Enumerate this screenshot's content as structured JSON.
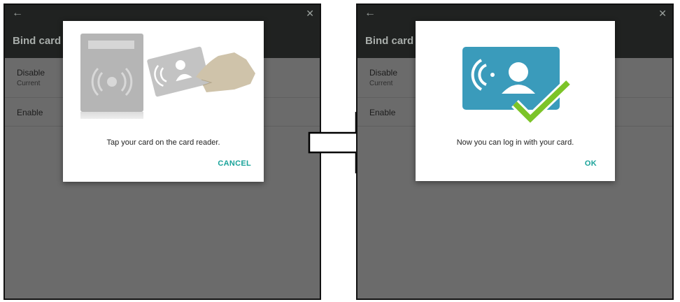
{
  "screens": [
    {
      "title": "Bind card t",
      "list": [
        {
          "primary": "Disable",
          "secondary": "Current"
        },
        {
          "primary": "Enable"
        }
      ],
      "dialog": {
        "message": "Tap your card on the card reader.",
        "action": "CANCEL"
      }
    },
    {
      "title": "Bind card f",
      "list": [
        {
          "primary": "Disable",
          "secondary": "Current"
        },
        {
          "primary": "Enable"
        }
      ],
      "dialog": {
        "message": "Now you can log in with your card.",
        "action": "OK"
      }
    }
  ],
  "icons": {
    "back": "arrow-left-icon",
    "close": "close-icon",
    "tap_illustration": "card-reader-tap-illustration",
    "success_illustration": "card-check-illustration"
  },
  "colors": {
    "app_bar": "#202221",
    "scrim": "#6b6b6b",
    "accent": "#1aa39a",
    "card_blue": "#3a9bbb",
    "check_green": "#7cc428"
  }
}
